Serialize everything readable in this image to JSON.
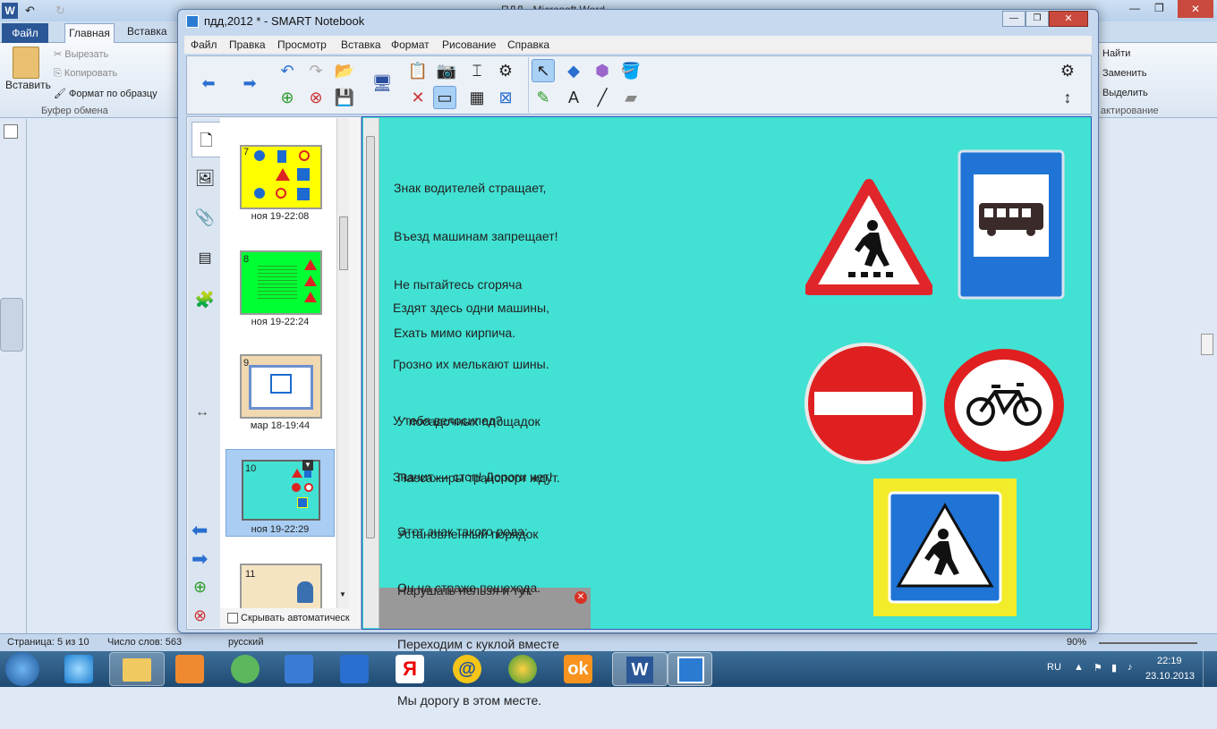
{
  "word": {
    "title": "ПДД - Microsoft Word",
    "file_tab": "Файл",
    "tabs": [
      "Главная",
      "Вставка"
    ],
    "paste_label": "Вставить",
    "cut_label": "Вырезать",
    "copy_label": "Копировать",
    "format_painter_label": "Формат по образцу",
    "clipboard_group": "Буфер обмена",
    "find_label": "Найти",
    "replace_label": "Заменить",
    "select_label": "Выделить",
    "editing_group": "актирование",
    "status": {
      "page": "Страница: 5 из 10",
      "words": "Число слов: 563",
      "language": "русский",
      "zoom": "90%"
    }
  },
  "smart": {
    "title": "пдд,2012 * - SMART Notebook",
    "menu": [
      "Файл",
      "Правка",
      "Просмотр",
      "Вставка",
      "Формат",
      "Рисование",
      "Справка"
    ],
    "slides": [
      {
        "num": "7",
        "time": "ноя 19-22:08",
        "bg": "#ffff00"
      },
      {
        "num": "8",
        "time": "ноя 19-22:24",
        "bg": "#00ff33"
      },
      {
        "num": "9",
        "time": "мар 18-19:44",
        "bg": "#f0d8b0"
      },
      {
        "num": "10",
        "time": "ноя 19-22:29",
        "bg": "#41e1d3"
      },
      {
        "num": "11",
        "time": "",
        "bg": "#f5e4c2"
      }
    ],
    "auto_hide_label": "Скрывать автоматическ",
    "poems": [
      [
        "Знак водителей стращает,",
        "Въезд машинам запрещает!",
        "Не пытайтесь сгоряча",
        "Ехать мимо кирпича."
      ],
      [
        "Ездят здесь одни машины,",
        "Грозно их мелькают шины.",
        "У тебя велосипед?",
        "Значит — стоп! Дороги нет!"
      ],
      [
        "У посадочных площадок",
        "Пассажиры транспорт ждут.",
        "Установленный порядок",
        "Нарушать нельзя и тут."
      ],
      [
        "Этот знак такого рода:",
        "Он на страже пешехода.",
        "Переходим с куклой вместе",
        "Мы дорогу в этом месте."
      ]
    ],
    "canvas_bg": "#41e1d3"
  },
  "taskbar": {
    "lang": "RU",
    "time": "22:19",
    "date": "23.10.2013"
  }
}
